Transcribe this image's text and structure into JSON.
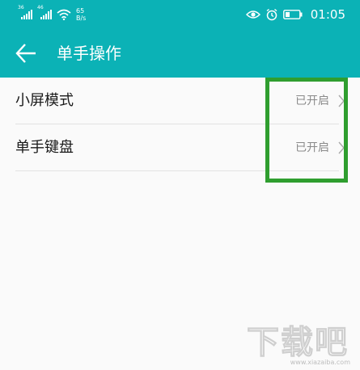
{
  "status_bar": {
    "sim1_tag": "36",
    "sim2_tag": "46",
    "net_speed_value": "65",
    "net_speed_unit": "B/s",
    "time": "01:05",
    "icons": [
      "signal-icon",
      "signal-icon",
      "wifi-icon",
      "eye-icon",
      "alarm-icon",
      "battery-icon"
    ]
  },
  "app_bar": {
    "title": "单手操作",
    "back_icon": "arrow-left-icon"
  },
  "settings": [
    {
      "label": "小屏模式",
      "value": "已开启"
    },
    {
      "label": "单手键盘",
      "value": "已开启"
    }
  ],
  "watermark": {
    "text": "下载吧",
    "url": "www.xiazaiba.com"
  },
  "colors": {
    "accent": "#0bb2b6",
    "highlight_box": "#2f9e2f",
    "background": "#fafafa"
  }
}
